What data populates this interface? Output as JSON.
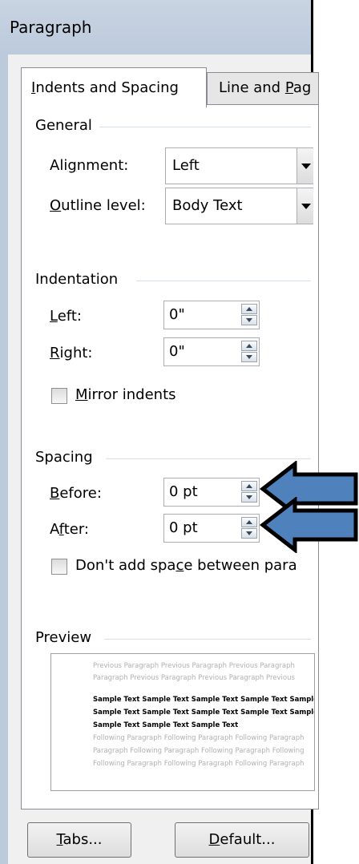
{
  "dialog": {
    "title": "Paragraph"
  },
  "tabs": [
    {
      "pre": "",
      "key": "I",
      "post": "ndents and Spacing"
    },
    {
      "pre": "Line and ",
      "key": "P",
      "post": "ag"
    }
  ],
  "general": {
    "label": "General",
    "alignment": {
      "pre": "Ali",
      "key": "g",
      "post": "nment:",
      "value": "Left"
    },
    "outline_level": {
      "pre": "",
      "key": "O",
      "post": "utline level:",
      "value": "Body Text"
    }
  },
  "indentation": {
    "label": "Indentation",
    "left": {
      "pre": "",
      "key": "L",
      "post": "eft:",
      "value": "0\""
    },
    "right": {
      "pre": "",
      "key": "R",
      "post": "ight:",
      "value": "0\""
    },
    "mirror": {
      "pre": "",
      "key": "M",
      "post": "irror indents"
    }
  },
  "spacing": {
    "label": "Spacing",
    "before": {
      "pre": "",
      "key": "B",
      "post": "efore:",
      "value": "0 pt"
    },
    "after": {
      "pre": "A",
      "key": "f",
      "post": "ter:",
      "value": "0 pt"
    },
    "dont_add": {
      "pre": "Don't add spa",
      "key": "c",
      "post": "e between para"
    }
  },
  "preview": {
    "label": "Preview",
    "previous_lines": [
      "Previous Paragraph Previous Paragraph Previous Paragraph",
      "Paragraph Previous Paragraph Previous Paragraph Previous"
    ],
    "sample_lines": [
      "Sample Text Sample Text Sample Text Sample Text Sample",
      "Sample Text Sample Text Sample Text Sample Text Sample",
      "Sample Text Sample Text Sample Text"
    ],
    "following_lines": [
      "Following Paragraph Following Paragraph Following Paragraph",
      "Paragraph Following Paragraph Following Paragraph Following",
      "Following Paragraph Following Paragraph Following Paragraph"
    ]
  },
  "buttons": {
    "tabs": {
      "pre": "",
      "key": "T",
      "post": "abs..."
    },
    "default": {
      "pre": "",
      "key": "D",
      "post": "efault..."
    }
  },
  "colors": {
    "annotation_arrow": "#4f81bd",
    "title_bar": "#bccadc"
  }
}
